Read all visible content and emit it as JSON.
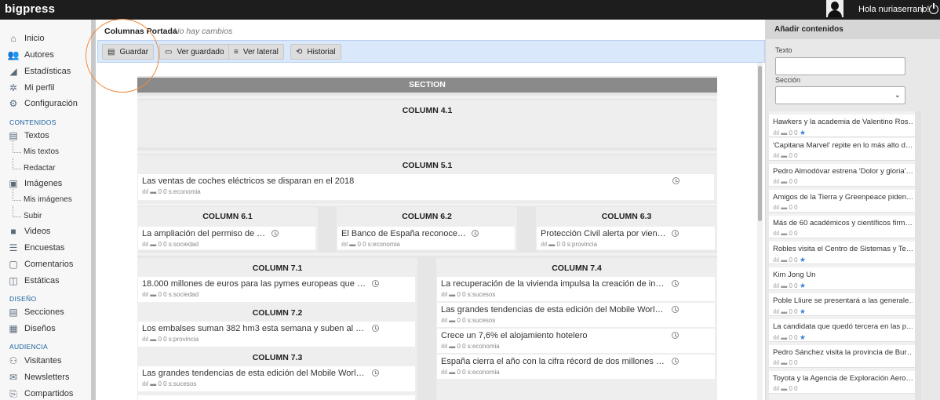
{
  "app": {
    "brand": "bigpress",
    "greeting": "Hola nuriaserrano!",
    "separator": "|"
  },
  "nav": {
    "inicio": "Inicio",
    "autores": "Autores",
    "estadisticas": "Estadísticas",
    "perfil": "Mi perfil",
    "config": "Configuración",
    "sec_contenidos": "CONTENIDOS",
    "textos": "Textos",
    "mis_textos": "Mis textos",
    "redactar": "Redactar",
    "imagenes": "Imágenes",
    "mis_imagenes": "Mis imágenes",
    "subir": "Subir",
    "videos": "Videos",
    "encuestas": "Encuestas",
    "comentarios": "Comentarios",
    "estaticas": "Estáticas",
    "sec_diseno": "DISEÑO",
    "secciones": "Secciones",
    "disenos": "Diseños",
    "sec_audiencia": "AUDIENCIA",
    "visitantes": "Visitantes",
    "newsletters": "Newsletters",
    "compartidos": "Compartidos"
  },
  "header": {
    "title": "Columnas Portada",
    "status": "No hay cambios"
  },
  "toolbar": {
    "guardar": "Guardar",
    "ver_guardado": "Ver guardado",
    "ver_lateral": "Ver lateral",
    "historial": "Historial"
  },
  "canvas": {
    "section": "SECTION",
    "c41": "COLUMN 4.1",
    "c51": "COLUMN 5.1",
    "c51_card": {
      "title": "Las ventas de coches eléctricos se disparan en el 2018",
      "meta": "0  0 s:economia"
    },
    "c61": "COLUMN 6.1",
    "c61_card": {
      "title": "La ampliación del permiso de …",
      "meta": "0  0 s:sociedad"
    },
    "c62": "COLUMN 6.2",
    "c62_card": {
      "title": "El Banco de España reconoce…",
      "meta": "0  0 s:economia"
    },
    "c63": "COLUMN 6.3",
    "c63_card": {
      "title": "Protección Civil alerta por vien…",
      "meta": "0  0 s:provincia"
    },
    "c71": "COLUMN 7.1",
    "c71_card": {
      "title": "18.000 millones de euros para las pymes europeas que …",
      "meta": "0  0 s:sociedad"
    },
    "c72": "COLUMN 7.2",
    "c72_card": {
      "title": "Los embalses suman 382 hm3 esta semana y suben al …",
      "meta": "0  0 s:provincia"
    },
    "c73": "COLUMN 7.3",
    "c73_card": {
      "title": "Las grandes tendencias de esta edición del Mobile Worl…",
      "meta": "0  0 s:sucesos"
    },
    "c74": "COLUMN 7.4",
    "c74_cards": [
      {
        "title": "La recuperación de la vivienda impulsa la creación de in…",
        "meta": "0  0 s:sucesos"
      },
      {
        "title": "Las grandes tendencias de esta edición del Mobile Worl…",
        "meta": "0  0 s:sucesos"
      },
      {
        "title": "Crece un 7,6% el alojamiento hotelero",
        "meta": "0  0 s:economia"
      },
      {
        "title": "España cierra el año con la cifra récord de dos millones …",
        "meta": "0  0 s:economia"
      }
    ]
  },
  "panel": {
    "title": "Añadir contenidos",
    "texto_label": "Texto",
    "seccion_label": "Sección",
    "items": [
      {
        "title": "Hawkers y la academia de Valentino Ros…",
        "meta": "0  0",
        "star": true
      },
      {
        "title": "'Capitana Marvel' repite en lo más alto d…",
        "meta": "0  0",
        "star": false
      },
      {
        "title": "Pedro Almodóvar estrena 'Dolor y gloria'…",
        "meta": "0  0",
        "star": false
      },
      {
        "title": "Amigos de la Tierra y Greenpeace piden…",
        "meta": "0  0",
        "star": false
      },
      {
        "title": "Más de 60 académicos y científicos firm…",
        "meta": "0  0",
        "star": false
      },
      {
        "title": "Robles visita el Centro de Sistemas y Te…",
        "meta": "0  0",
        "star": true
      },
      {
        "title": "Kim Jong Un",
        "meta": "0  0",
        "star": true
      },
      {
        "title": "Poble Lliure se presentará a las generale…",
        "meta": "0  0",
        "star": true
      },
      {
        "title": "La candidata que quedó tercera en las p…",
        "meta": "0  0",
        "star": true
      },
      {
        "title": "Pedro Sánchez visita la provincia de Bur…",
        "meta": "0  0",
        "star": false
      },
      {
        "title": "Toyota y la Agencia de Exploración Aero…",
        "meta": "0  0",
        "star": false
      }
    ]
  }
}
